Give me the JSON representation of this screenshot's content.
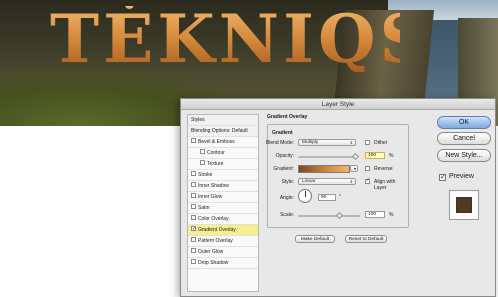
{
  "background": {
    "logo_text": "TĖKNIQS"
  },
  "dialog": {
    "title": "Layer Style",
    "sidebar": {
      "items": [
        {
          "label": "Styles",
          "kind": "header"
        },
        {
          "label": "Blending Options: Default",
          "kind": "header"
        },
        {
          "label": "Bevel & Emboss",
          "checked": false
        },
        {
          "label": "Contour",
          "checked": false,
          "sub": true
        },
        {
          "label": "Texture",
          "checked": false,
          "sub": true
        },
        {
          "label": "Stroke",
          "checked": false
        },
        {
          "label": "Inner Shadow",
          "checked": false
        },
        {
          "label": "Inner Glow",
          "checked": false
        },
        {
          "label": "Satin",
          "checked": false
        },
        {
          "label": "Color Overlay",
          "checked": false
        },
        {
          "label": "Gradient Overlay",
          "checked": true,
          "active": true
        },
        {
          "label": "Pattern Overlay",
          "checked": false
        },
        {
          "label": "Outer Glow",
          "checked": false
        },
        {
          "label": "Drop Shadow",
          "checked": false
        }
      ]
    },
    "panel": {
      "group_title": "Gradient Overlay",
      "sub_title": "Gradient",
      "blend_mode_label": "Blend Mode:",
      "blend_mode_value": "Multiply",
      "dither_label": "Dither",
      "dither_checked": false,
      "opacity_label": "Opacity:",
      "opacity_value": "100",
      "opacity_unit": "%",
      "opacity_fraction": 1.0,
      "gradient_label": "Gradient:",
      "reverse_label": "Reverse",
      "reverse_checked": false,
      "style_label": "Style:",
      "style_value": "Linear",
      "align_label": "Align with Layer",
      "align_checked": true,
      "angle_label": "Angle:",
      "angle_value": "90",
      "angle_unit": "°",
      "scale_label": "Scale:",
      "scale_value": "100",
      "scale_unit": "%",
      "scale_fraction": 0.67,
      "make_default_label": "Make Default",
      "reset_default_label": "Reset to Default"
    },
    "buttons": {
      "ok": "OK",
      "cancel": "Cancel",
      "new_style": "New Style...",
      "preview_label": "Preview",
      "preview_checked": true
    },
    "colors": {
      "gradient_dark": "#7a4a22",
      "gradient_mid": "#d88d40",
      "gradient_light": "#f0b66b",
      "preview_swatch": "#4e3a1d",
      "active_row": "#f7ef8f"
    }
  }
}
